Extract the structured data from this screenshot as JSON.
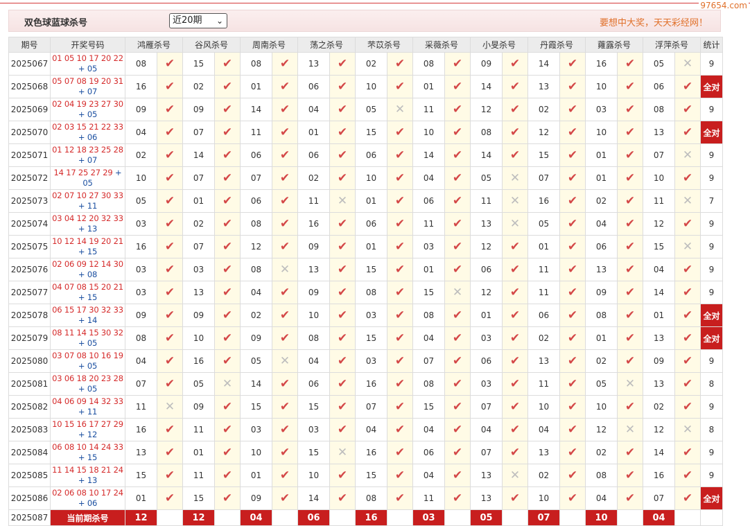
{
  "site": {
    "watermark": "97654.com"
  },
  "header": {
    "title": "双色球蓝球杀号",
    "range_select": {
      "value": "近20期"
    },
    "slogan": "要想中大奖，天天彩经网！"
  },
  "columns": {
    "period": "期号",
    "draw": "开奖号码",
    "experts": [
      "鸿雁杀号",
      "谷风杀号",
      "周南杀号",
      "荡之杀号",
      "芣苡杀号",
      "采薇杀号",
      "小旻杀号",
      "丹霞杀号",
      "蕹露杀号",
      "浮萍杀号"
    ],
    "stat": "统计"
  },
  "rows": [
    {
      "period": "2025067",
      "red": "01 05 10 17 20 22",
      "blue": "05",
      "kills": [
        "08",
        "15",
        "08",
        "13",
        "02",
        "08",
        "09",
        "14",
        "16",
        "05"
      ],
      "res": [
        1,
        1,
        1,
        1,
        1,
        1,
        1,
        1,
        1,
        0
      ],
      "stat": "9"
    },
    {
      "period": "2025068",
      "red": "05 07 08 19 20 31",
      "blue": "07",
      "kills": [
        "16",
        "02",
        "01",
        "06",
        "10",
        "01",
        "14",
        "13",
        "10",
        "06"
      ],
      "res": [
        1,
        1,
        1,
        1,
        1,
        1,
        1,
        1,
        1,
        1
      ],
      "stat": "全对"
    },
    {
      "period": "2025069",
      "red": "02 04 19 23 27 30",
      "blue": "05",
      "kills": [
        "09",
        "09",
        "14",
        "04",
        "05",
        "11",
        "12",
        "02",
        "03",
        "08"
      ],
      "res": [
        1,
        1,
        1,
        1,
        0,
        1,
        1,
        1,
        1,
        1
      ],
      "stat": "9"
    },
    {
      "period": "2025070",
      "red": "02 03 15 21 22 33",
      "blue": "06",
      "kills": [
        "04",
        "07",
        "11",
        "01",
        "15",
        "10",
        "08",
        "12",
        "10",
        "13"
      ],
      "res": [
        1,
        1,
        1,
        1,
        1,
        1,
        1,
        1,
        1,
        1
      ],
      "stat": "全对"
    },
    {
      "period": "2025071",
      "red": "01 12 18 23 25 28",
      "blue": "07",
      "kills": [
        "02",
        "14",
        "06",
        "06",
        "06",
        "14",
        "14",
        "15",
        "01",
        "07"
      ],
      "res": [
        1,
        1,
        1,
        1,
        1,
        1,
        1,
        1,
        1,
        0
      ],
      "stat": "9"
    },
    {
      "period": "2025072",
      "red": "14 17 25 27 29",
      "blue": "05",
      "kills": [
        "10",
        "07",
        "07",
        "02",
        "10",
        "04",
        "05",
        "07",
        "01",
        "10"
      ],
      "res": [
        1,
        1,
        1,
        1,
        1,
        1,
        0,
        1,
        1,
        1
      ],
      "stat": "9"
    },
    {
      "period": "2025073",
      "red": "02 07 10 27 30 33",
      "blue": "11",
      "kills": [
        "05",
        "01",
        "06",
        "11",
        "01",
        "06",
        "11",
        "16",
        "02",
        "11"
      ],
      "res": [
        1,
        1,
        1,
        0,
        1,
        1,
        0,
        1,
        1,
        0
      ],
      "stat": "7"
    },
    {
      "period": "2025074",
      "red": "03 04 12 20 32 33",
      "blue": "13",
      "kills": [
        "03",
        "02",
        "08",
        "16",
        "06",
        "11",
        "13",
        "05",
        "04",
        "12"
      ],
      "res": [
        1,
        1,
        1,
        1,
        1,
        1,
        0,
        1,
        1,
        1
      ],
      "stat": "9"
    },
    {
      "period": "2025075",
      "red": "10 12 14 19 20 21",
      "blue": "15",
      "kills": [
        "16",
        "07",
        "12",
        "09",
        "01",
        "03",
        "12",
        "01",
        "06",
        "15"
      ],
      "res": [
        1,
        1,
        1,
        1,
        1,
        1,
        1,
        1,
        1,
        0
      ],
      "stat": "9"
    },
    {
      "period": "2025076",
      "red": "02 06 09 12 14 30",
      "blue": "08",
      "kills": [
        "03",
        "03",
        "08",
        "13",
        "15",
        "01",
        "06",
        "11",
        "13",
        "04"
      ],
      "res": [
        1,
        1,
        0,
        1,
        1,
        1,
        1,
        1,
        1,
        1
      ],
      "stat": "9"
    },
    {
      "period": "2025077",
      "red": "04 07 08 15 20 21",
      "blue": "15",
      "kills": [
        "03",
        "13",
        "04",
        "09",
        "08",
        "15",
        "12",
        "11",
        "09",
        "14"
      ],
      "res": [
        1,
        1,
        1,
        1,
        1,
        0,
        1,
        1,
        1,
        1
      ],
      "stat": "9"
    },
    {
      "period": "2025078",
      "red": "06 15 17 30 32 33",
      "blue": "14",
      "kills": [
        "09",
        "09",
        "02",
        "10",
        "03",
        "08",
        "01",
        "06",
        "08",
        "01"
      ],
      "res": [
        1,
        1,
        1,
        1,
        1,
        1,
        1,
        1,
        1,
        1
      ],
      "stat": "全对"
    },
    {
      "period": "2025079",
      "red": "08 11 14 15 30 32",
      "blue": "05",
      "kills": [
        "08",
        "10",
        "09",
        "08",
        "15",
        "04",
        "03",
        "02",
        "01",
        "13"
      ],
      "res": [
        1,
        1,
        1,
        1,
        1,
        1,
        1,
        1,
        1,
        1
      ],
      "stat": "全对"
    },
    {
      "period": "2025080",
      "red": "03 07 08 10 16 19",
      "blue": "05",
      "kills": [
        "04",
        "16",
        "05",
        "04",
        "03",
        "07",
        "06",
        "13",
        "02",
        "09"
      ],
      "res": [
        1,
        1,
        0,
        1,
        1,
        1,
        1,
        1,
        1,
        1
      ],
      "stat": "9"
    },
    {
      "period": "2025081",
      "red": "03 06 18 20 23 28",
      "blue": "05",
      "kills": [
        "07",
        "05",
        "14",
        "06",
        "16",
        "08",
        "03",
        "11",
        "05",
        "13"
      ],
      "res": [
        1,
        0,
        1,
        1,
        1,
        1,
        1,
        1,
        0,
        1
      ],
      "stat": "8"
    },
    {
      "period": "2025082",
      "red": "04 06 09 14 32 33",
      "blue": "11",
      "kills": [
        "11",
        "09",
        "15",
        "15",
        "07",
        "15",
        "07",
        "10",
        "10",
        "02"
      ],
      "res": [
        0,
        1,
        1,
        1,
        1,
        1,
        1,
        1,
        1,
        1
      ],
      "stat": "9"
    },
    {
      "period": "2025083",
      "red": "10 15 16 17 27 29",
      "blue": "12",
      "kills": [
        "16",
        "11",
        "03",
        "03",
        "04",
        "04",
        "04",
        "04",
        "12",
        "12"
      ],
      "res": [
        1,
        1,
        1,
        1,
        1,
        1,
        1,
        1,
        0,
        0
      ],
      "stat": "8"
    },
    {
      "period": "2025084",
      "red": "06 08 10 14 24 33",
      "blue": "15",
      "kills": [
        "13",
        "01",
        "10",
        "15",
        "16",
        "06",
        "07",
        "13",
        "02",
        "14"
      ],
      "res": [
        1,
        1,
        1,
        0,
        1,
        1,
        1,
        1,
        1,
        1
      ],
      "stat": "9"
    },
    {
      "period": "2025085",
      "red": "11 14 15 18 21 24",
      "blue": "13",
      "kills": [
        "15",
        "11",
        "01",
        "10",
        "15",
        "04",
        "13",
        "02",
        "08",
        "16"
      ],
      "res": [
        1,
        1,
        1,
        1,
        1,
        1,
        0,
        1,
        1,
        1
      ],
      "stat": "9"
    },
    {
      "period": "2025086",
      "red": "02 06 08 10 17 24",
      "blue": "06",
      "kills": [
        "01",
        "15",
        "09",
        "14",
        "08",
        "11",
        "13",
        "10",
        "04",
        "07"
      ],
      "res": [
        1,
        1,
        1,
        1,
        1,
        1,
        1,
        1,
        1,
        1
      ],
      "stat": "全对"
    }
  ],
  "current": {
    "period": "2025087",
    "label": "当前期杀号",
    "kills": [
      "12",
      "12",
      "04",
      "06",
      "16",
      "03",
      "05",
      "07",
      "10",
      "04"
    ]
  }
}
